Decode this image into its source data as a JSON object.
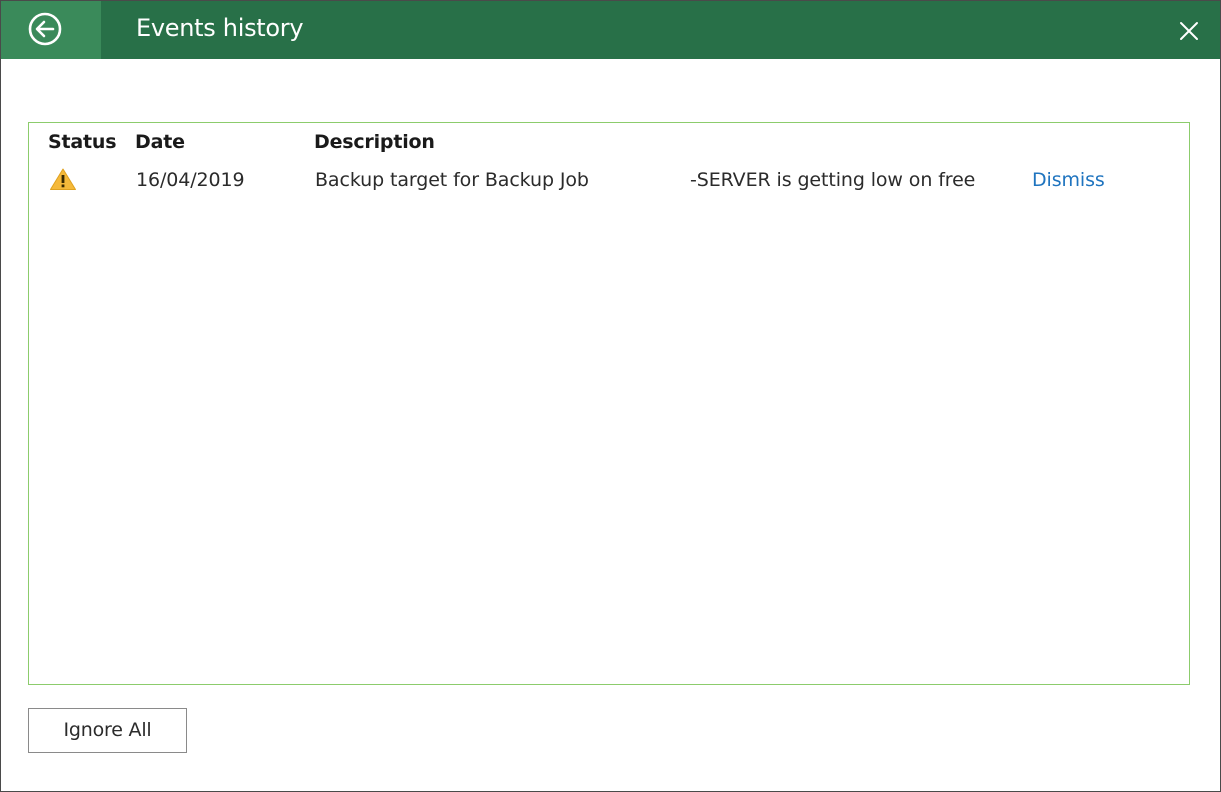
{
  "window": {
    "title": "Events history",
    "back_icon": "back-arrow-circle-icon",
    "close_icon": "close-icon",
    "accent_color": "#287048"
  },
  "table": {
    "columns": [
      "Status",
      "Date",
      "Description"
    ],
    "rows": [
      {
        "status_icon": "warning-icon",
        "date": "16/04/2019",
        "description_part1": "Backup target for Backup Job",
        "description_part2": "-SERVER is getting low on free",
        "action_label": "Dismiss"
      }
    ]
  },
  "footer": {
    "ignore_all_label": "Ignore All"
  }
}
